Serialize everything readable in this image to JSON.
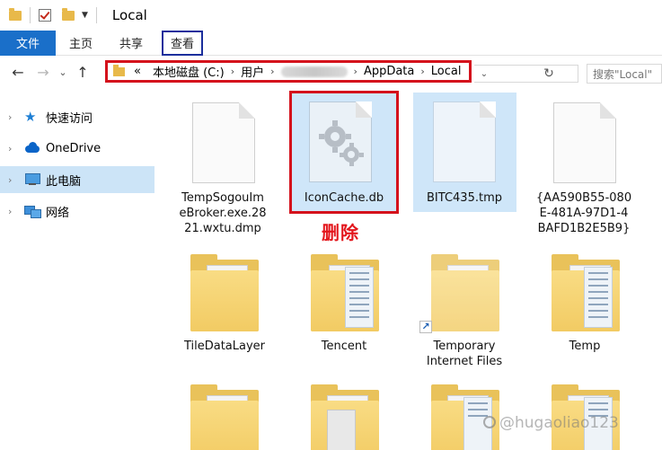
{
  "window": {
    "title": "Local"
  },
  "ribbon": {
    "tabs": [
      {
        "label": "文件"
      },
      {
        "label": "主页"
      },
      {
        "label": "共享"
      },
      {
        "label": "查看"
      }
    ]
  },
  "address": {
    "overflow": "«",
    "crumbs": [
      "本地磁盘 (C:)",
      "用户",
      "AppData",
      "Local"
    ],
    "search_placeholder": "搜索\"Local\""
  },
  "nav": {
    "items": [
      {
        "label": "快速访问",
        "icon": "star-icon"
      },
      {
        "label": "OneDrive",
        "icon": "cloud-icon"
      },
      {
        "label": "此电脑",
        "icon": "computer-icon",
        "selected": true
      },
      {
        "label": "网络",
        "icon": "network-icon"
      }
    ]
  },
  "files": [
    {
      "name": "TempSogouImeBroker.exe.2821.wxtu.dmp",
      "lines": [
        "TempSogouIm",
        "eBroker.exe.28",
        "21.wxtu.dmp"
      ],
      "kind": "file"
    },
    {
      "name": "IconCache.db",
      "lines": [
        "IconCache.db"
      ],
      "kind": "system-file",
      "selected": true
    },
    {
      "name": "BITC435.tmp",
      "lines": [
        "BITC435.tmp"
      ],
      "kind": "file",
      "selected": true
    },
    {
      "name": "{AA590B55-080E-481A-97D1-4BAFD1B2E5B9}",
      "lines": [
        "{AA590B55-080",
        "E-481A-97D1-4",
        "BAFD1B2E5B9}"
      ],
      "kind": "file"
    },
    {
      "name": "TileDataLayer",
      "lines": [
        "TileDataLayer"
      ],
      "kind": "folder"
    },
    {
      "name": "Tencent",
      "lines": [
        "Tencent"
      ],
      "kind": "folder"
    },
    {
      "name": "Temporary Internet Files",
      "lines": [
        "Temporary",
        "Internet Files"
      ],
      "kind": "folder-shortcut"
    },
    {
      "name": "Temp",
      "lines": [
        "Temp"
      ],
      "kind": "folder"
    }
  ],
  "annotation": {
    "delete_label": "删除"
  },
  "watermark": {
    "text": "@hugaoliao123"
  },
  "colors": {
    "file_tab": "#1a6fc9",
    "annotation_red": "#d4121c",
    "view_tab_box": "#1b2e9c",
    "selection": "#cce4f7"
  }
}
